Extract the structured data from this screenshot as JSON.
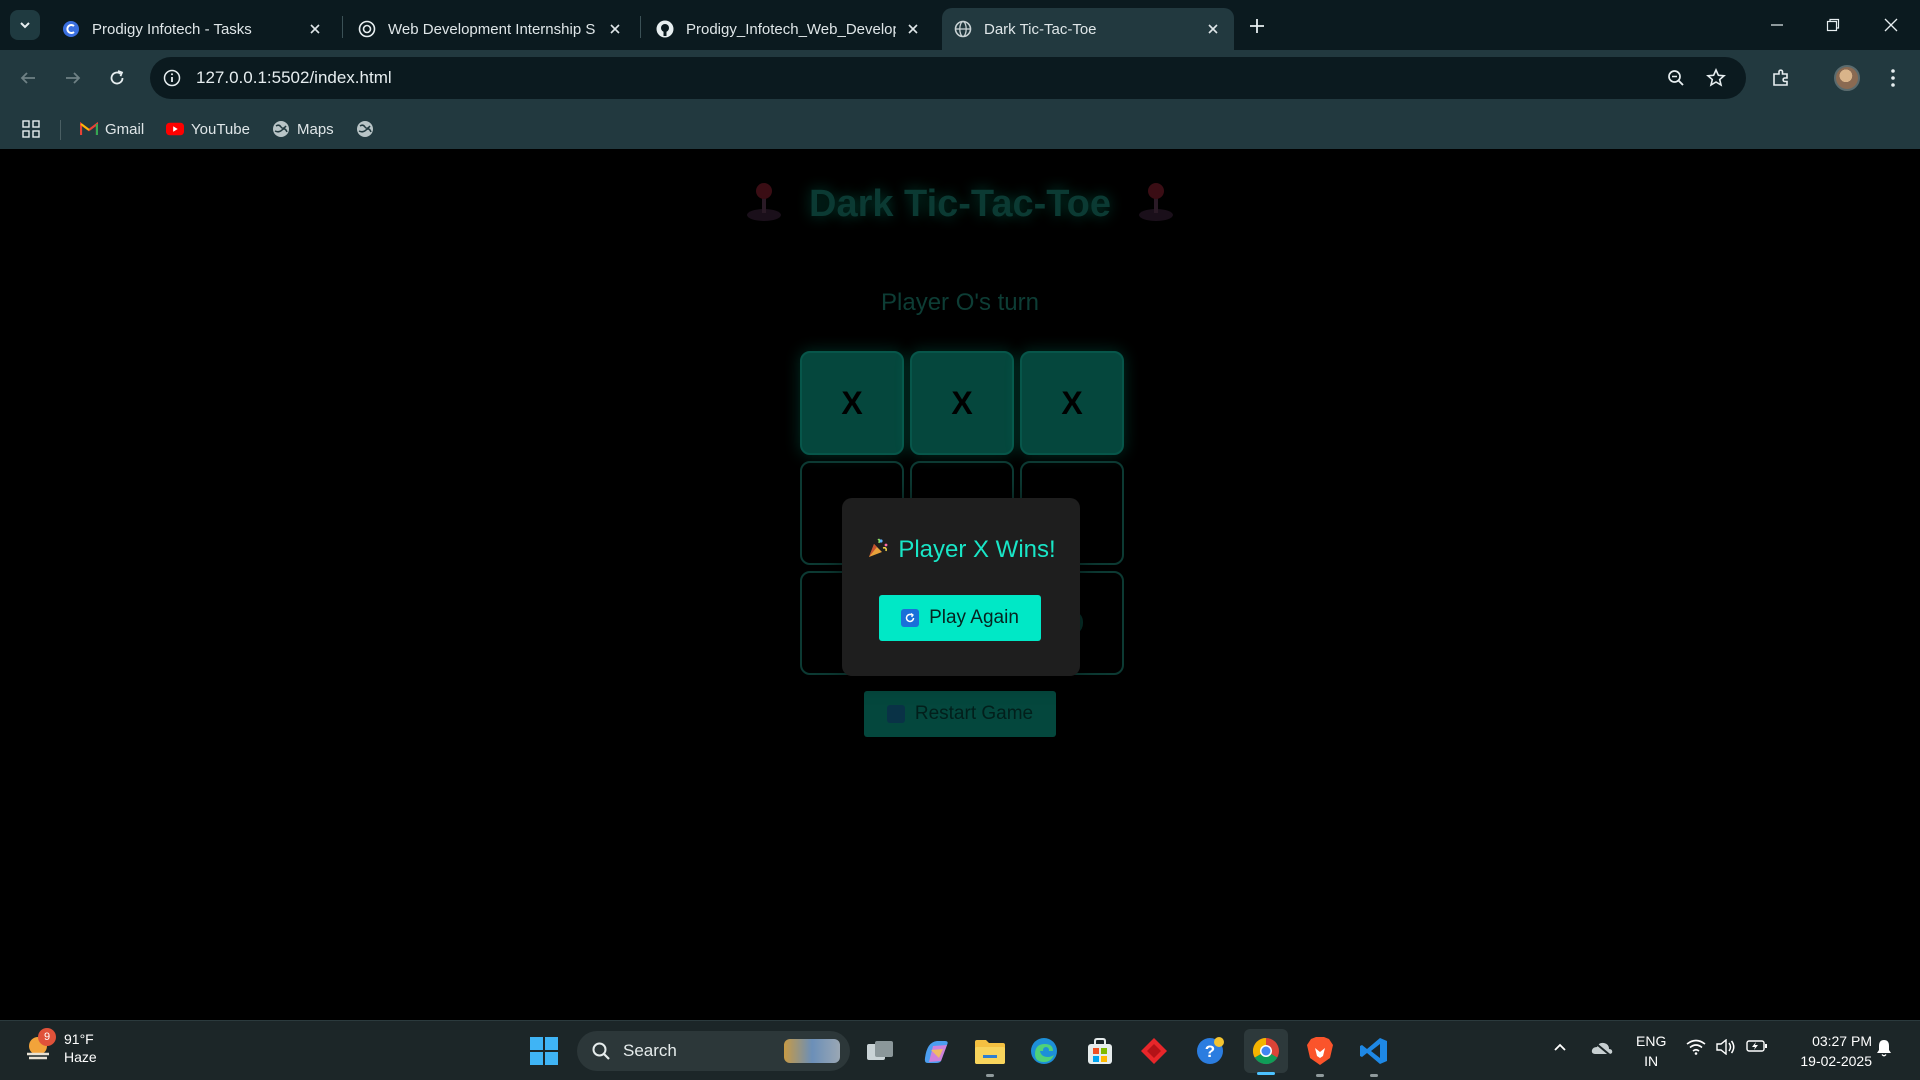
{
  "browser": {
    "tabs": [
      {
        "title": "Prodigy Infotech - Tasks",
        "favicon": "prodigy-icon",
        "active": false
      },
      {
        "title": "Web Development Internship S",
        "favicon": "openai-icon",
        "active": false
      },
      {
        "title": "Prodigy_Infotech_Web_Develop",
        "favicon": "github-icon",
        "active": false
      },
      {
        "title": "Dark Tic-Tac-Toe",
        "favicon": "globe-icon",
        "active": true
      }
    ],
    "url": "127.0.0.1:5502/index.html",
    "bookmarks": [
      {
        "label": "Gmail",
        "icon": "gmail-icon"
      },
      {
        "label": "YouTube",
        "icon": "youtube-icon"
      },
      {
        "label": "Maps",
        "icon": "maps-icon"
      }
    ]
  },
  "game": {
    "title": "Dark Tic-Tac-Toe",
    "status": "Player O's turn",
    "cells": [
      "X",
      "X",
      "X",
      "",
      "",
      "",
      "",
      "",
      "O"
    ],
    "restart_label": "Restart Game",
    "modal": {
      "message": "Player X Wins!",
      "button_label": "Play Again"
    },
    "colors": {
      "accent": "#00e8c6",
      "win_cell": "#05473d",
      "modal_bg": "#1e1e1e"
    }
  },
  "taskbar": {
    "weather": {
      "badge": "9",
      "temp": "91°F",
      "condition": "Haze"
    },
    "search_placeholder": "Search",
    "language": {
      "line1": "ENG",
      "line2": "IN"
    },
    "time": "03:27 PM",
    "date": "19-02-2025"
  }
}
